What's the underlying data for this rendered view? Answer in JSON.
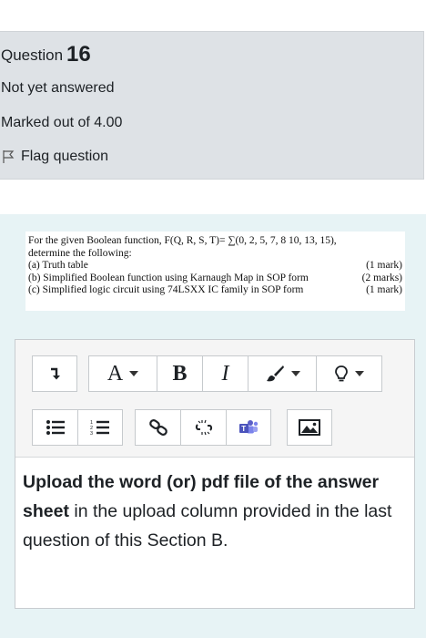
{
  "question": {
    "label": "Question",
    "number": "16",
    "state": "Not yet answered",
    "grade": "Marked out of 4.00",
    "flag_label": "Flag question"
  },
  "question_text": {
    "line1": "For the given Boolean function, F(Q, R, S, T)= ∑(0, 2, 5, 7, 8 10, 13, 15),",
    "line2": "determine the following:",
    "a_text": "(a) Truth table",
    "a_marks": "(1 mark)",
    "b_text": "(b) Simplified Boolean function using Karnaugh Map in SOP form",
    "b_marks": "(2 marks)",
    "c_text": "(c) Simplified logic circuit using 74LSXX IC family in SOP form",
    "c_marks": "(1 mark)"
  },
  "toolbar": {
    "font_size_label": "A",
    "bold_label": "B",
    "italic_label": "I",
    "icons": [
      "collapse-icon",
      "font-size-icon",
      "bold-icon",
      "italic-icon",
      "text-color-icon",
      "lightbulb-icon",
      "bullet-list-icon",
      "numbered-list-icon",
      "link-icon",
      "unlink-icon",
      "teams-icon",
      "image-icon"
    ]
  },
  "editor": {
    "bold_text": "Upload the word (or) pdf file of the answer sheet",
    "normal_text": " in the upload column provided in the last question of this Section B."
  }
}
